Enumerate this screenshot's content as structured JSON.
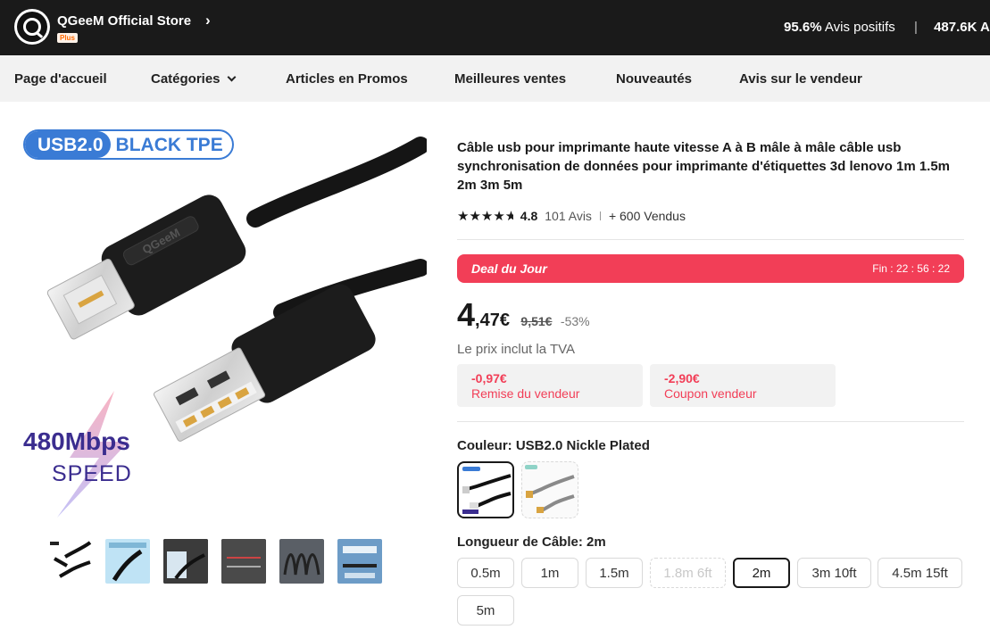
{
  "store": {
    "name": "QGeeM Official Store",
    "badge": "Plus",
    "logo_text": "QGeeM",
    "positive_pct": "95.6%",
    "positive_label": "Avis positifs",
    "followers": "487.6K A"
  },
  "nav": {
    "items": [
      {
        "label": "Page d'accueil"
      },
      {
        "label": "Catégories"
      },
      {
        "label": "Articles en Promos"
      },
      {
        "label": "Meilleures ventes"
      },
      {
        "label": "Nouveautés"
      },
      {
        "label": "Avis sur le vendeur"
      }
    ]
  },
  "image": {
    "badge_left": "USB2.0",
    "badge_right": "BLACK TPE",
    "brand_on_cable": "QGeeM",
    "speed_value": "480Mbps",
    "speed_label": "SPEED"
  },
  "product": {
    "title": "Câble usb pour imprimante haute vitesse A à B mâle à mâle câble usb synchronisation de données pour imprimante d'étiquettes 3d lenovo 1m 1.5m 2m 3m 5m",
    "rating": "4.8",
    "rating_stars": 4.8,
    "reviews": "101 Avis",
    "sold": "+ 600 Vendus"
  },
  "deal": {
    "title": "Deal du Jour",
    "timer": "Fin : 22 : 56 : 22"
  },
  "price": {
    "integer": "4",
    "decimal": ",47€",
    "old": "9,51€",
    "discount": "-53%",
    "vat_note": "Le prix inclut la TVA"
  },
  "promos": [
    {
      "amount": "-0,97€",
      "label": "Remise du vendeur"
    },
    {
      "amount": "-2,90€",
      "label": "Coupon vendeur"
    }
  ],
  "color": {
    "label": "Couleur:",
    "value": "USB2.0 Nickle Plated"
  },
  "length": {
    "label": "Longueur de Câble:",
    "value": "2m",
    "options": [
      "0.5m",
      "1m",
      "1.5m",
      "1.8m 6ft",
      "2m",
      "3m 10ft",
      "4.5m 15ft",
      "5m"
    ]
  },
  "colors": {
    "accent_red": "#f23e57",
    "badge_blue": "#3a7bd5",
    "speed_purple": "#3b2d8f"
  }
}
